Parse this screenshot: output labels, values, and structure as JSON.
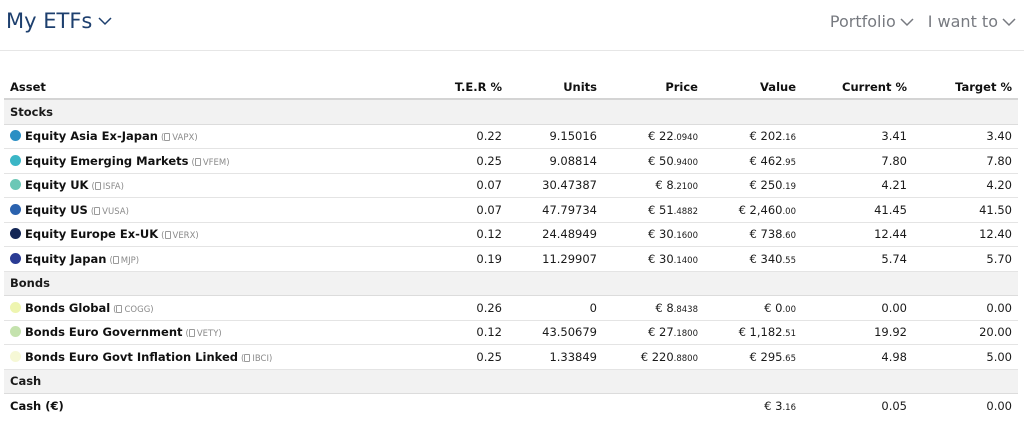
{
  "header": {
    "title": "My ETFs",
    "nav": [
      {
        "label": "Portfolio"
      },
      {
        "label": "I want to"
      }
    ]
  },
  "table": {
    "columns": [
      "Asset",
      "T.E.R %",
      "Units",
      "Price",
      "Value",
      "Current %",
      "Target %"
    ],
    "groups": [
      {
        "label": "Stocks",
        "rows": [
          {
            "name": "Equity Asia Ex-Japan",
            "ticker": "VAPX",
            "color": "#2b8fc4",
            "ter": "0.22",
            "units": "9.15016",
            "price_main": "€ 22",
            "price_dec": ".0940",
            "value_main": "€ 202",
            "value_dec": ".16",
            "current": "3.41",
            "target": "3.40"
          },
          {
            "name": "Equity Emerging Markets",
            "ticker": "VFEM",
            "color": "#3bb6c6",
            "ter": "0.25",
            "units": "9.08814",
            "price_main": "€ 50",
            "price_dec": ".9400",
            "value_main": "€ 462",
            "value_dec": ".95",
            "current": "7.80",
            "target": "7.80"
          },
          {
            "name": "Equity UK",
            "ticker": "ISFA",
            "color": "#6cc7b6",
            "ter": "0.07",
            "units": "30.47387",
            "price_main": "€ 8",
            "price_dec": ".2100",
            "value_main": "€ 250",
            "value_dec": ".19",
            "current": "4.21",
            "target": "4.20"
          },
          {
            "name": "Equity US",
            "ticker": "VUSA",
            "color": "#2a62ae",
            "ter": "0.07",
            "units": "47.79734",
            "price_main": "€ 51",
            "price_dec": ".4882",
            "value_main": "€ 2,460",
            "value_dec": ".00",
            "current": "41.45",
            "target": "41.50"
          },
          {
            "name": "Equity Europe Ex-UK",
            "ticker": "VERX",
            "color": "#132656",
            "ter": "0.12",
            "units": "24.48949",
            "price_main": "€ 30",
            "price_dec": ".1600",
            "value_main": "€ 738",
            "value_dec": ".60",
            "current": "12.44",
            "target": "12.40"
          },
          {
            "name": "Equity Japan",
            "ticker": "MJP",
            "color": "#2a3b94",
            "ter": "0.19",
            "units": "11.29907",
            "price_main": "€ 30",
            "price_dec": ".1400",
            "value_main": "€ 340",
            "value_dec": ".55",
            "current": "5.74",
            "target": "5.70"
          }
        ]
      },
      {
        "label": "Bonds",
        "rows": [
          {
            "name": "Bonds Global",
            "ticker": "COGG",
            "color": "#eef5b0",
            "ter": "0.26",
            "units": "0",
            "price_main": "€ 8",
            "price_dec": ".8438",
            "value_main": "€ 0",
            "value_dec": ".00",
            "current": "0.00",
            "target": "0.00"
          },
          {
            "name": "Bonds Euro Government",
            "ticker": "VETY",
            "color": "#c4e2ad",
            "ter": "0.12",
            "units": "43.50679",
            "price_main": "€ 27",
            "price_dec": ".1800",
            "value_main": "€ 1,182",
            "value_dec": ".51",
            "current": "19.92",
            "target": "20.00"
          },
          {
            "name": "Bonds Euro Govt Inflation Linked",
            "ticker": "IBCI",
            "color": "#f6f8d6",
            "ter": "0.25",
            "units": "1.33849",
            "price_main": "€ 220",
            "price_dec": ".8800",
            "value_main": "€ 295",
            "value_dec": ".65",
            "current": "4.98",
            "target": "5.00"
          }
        ]
      },
      {
        "label": "Cash",
        "rows": [
          {
            "name": "Cash (€)",
            "ticker": "",
            "color": "",
            "ter": "",
            "units": "",
            "price_main": "",
            "price_dec": "",
            "value_main": "€ 3",
            "value_dec": ".16",
            "current": "0.05",
            "target": "0.00"
          }
        ]
      }
    ]
  }
}
